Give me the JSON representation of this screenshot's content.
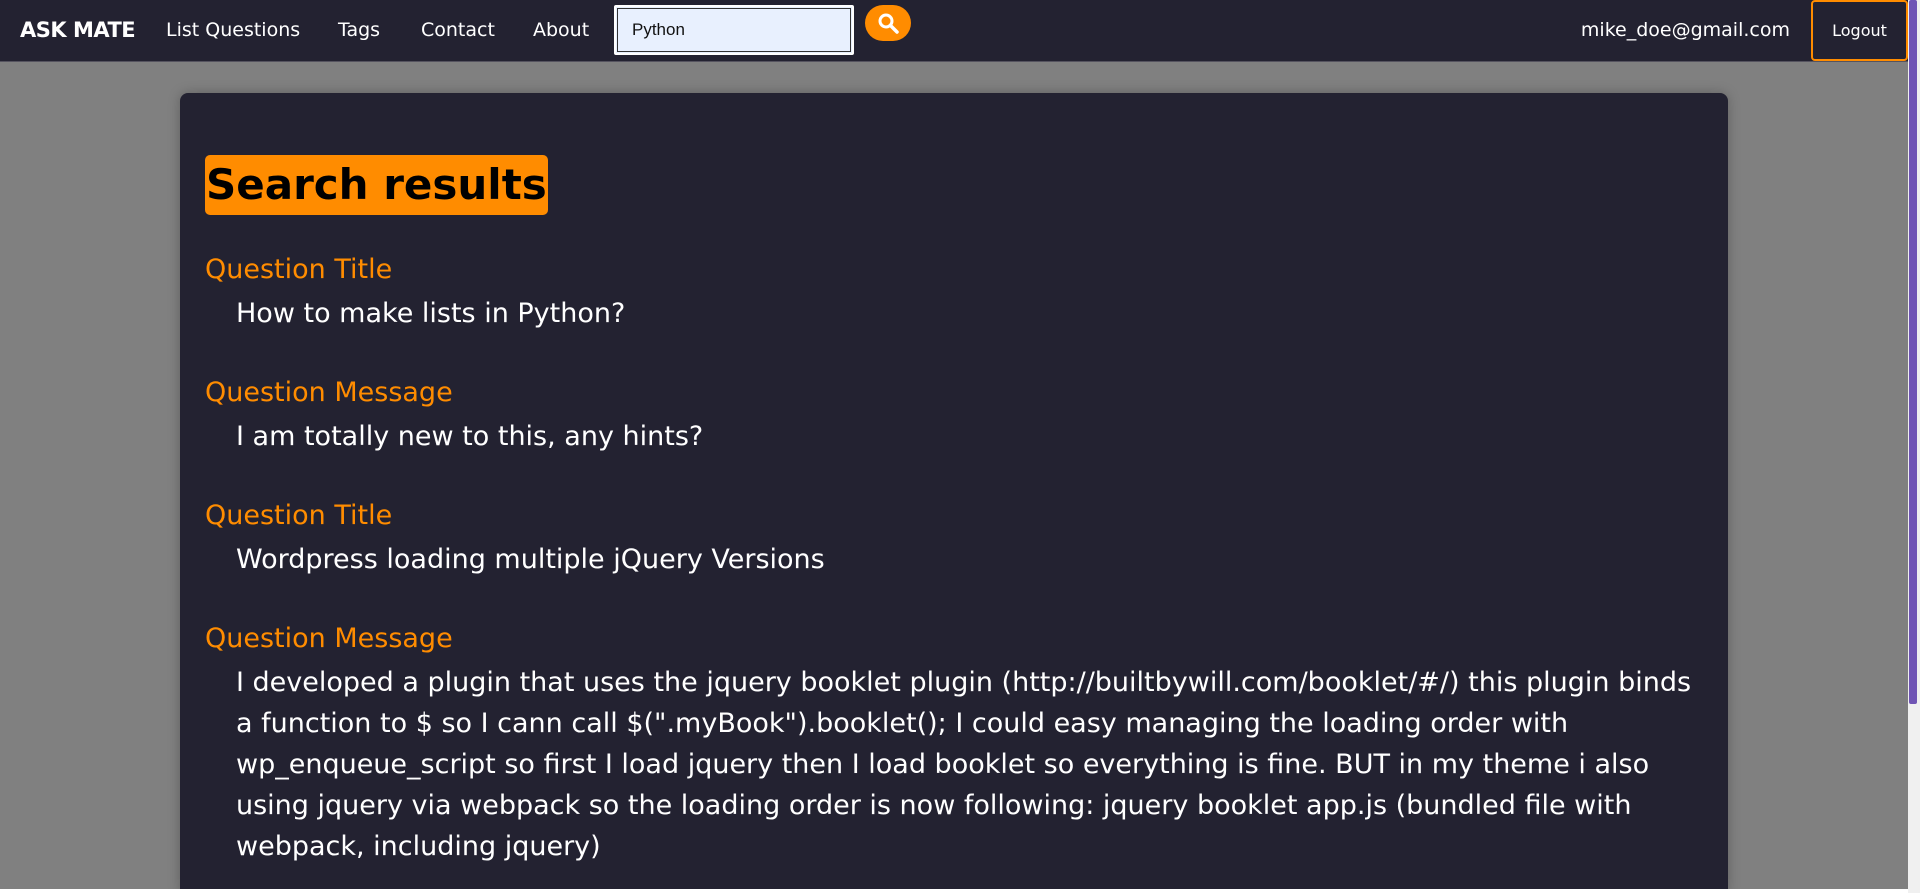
{
  "nav": {
    "brand": "ASK MATE",
    "links": [
      "List Questions",
      "Tags",
      "Contact",
      "About"
    ],
    "search": {
      "value": "Python",
      "icon": "search-icon"
    },
    "user_email": "mike_doe@gmail.com",
    "logout_label": "Logout"
  },
  "colors": {
    "accent": "#ff8c00",
    "nav_bg": "#232231",
    "card_bg": "#232231",
    "page_bg": "#808080",
    "text": "#ffffff",
    "scroll_thumb": "#7055b5"
  },
  "main": {
    "heading": "Search results",
    "results": [
      {
        "label": "Question Title",
        "text": "How to make lists in Python?"
      },
      {
        "label": "Question Message",
        "text": "I am totally new to this, any hints?"
      },
      {
        "label": "Question Title",
        "text": "Wordpress loading multiple jQuery Versions"
      },
      {
        "label": "Question Message",
        "text": "I developed a plugin that uses the jquery booklet plugin (http://builtbywill.com/booklet/#/) this plugin binds a function to $ so I cann call $(\".myBook\").booklet(); I could easy managing the loading order with wp_enqueue_script so first I load jquery then I load booklet so everything is fine. BUT in my theme i also using jquery via webpack so the loading order is now following: jquery booklet app.js (bundled file with webpack, including jquery)"
      }
    ]
  }
}
